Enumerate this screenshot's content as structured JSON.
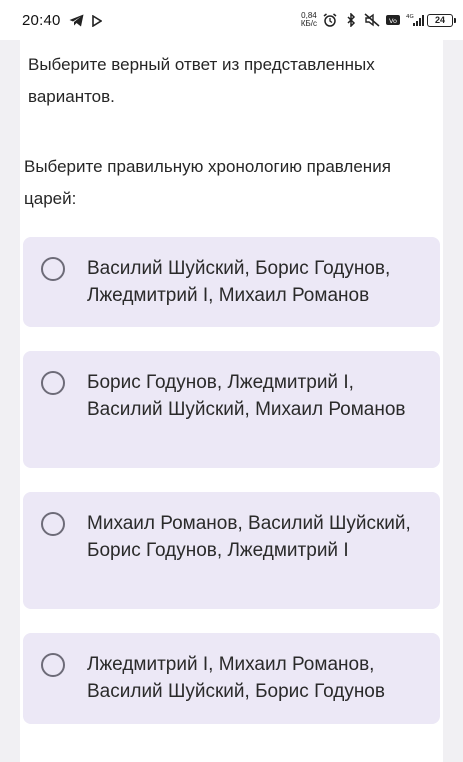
{
  "status_bar": {
    "time": "20:40",
    "net_speed_value": "0,84",
    "net_speed_unit": "КБ/с",
    "network_type": "4G",
    "battery": "24"
  },
  "instruction": "Выберите верный ответ из представленных вариантов.",
  "question": "Выберите правильную хронологию правления царей:",
  "options": [
    {
      "label": "Василий Шуйский, Борис Годунов, Лжедмитрий I, Михаил Романов",
      "selected": false
    },
    {
      "label": "Борис Годунов, Лжедмитрий I, Василий Шуйский, Михаил Романов",
      "selected": false
    },
    {
      "label": "Михаил Романов, Василий Шуйский, Борис Годунов, Лжедмитрий I",
      "selected": false
    },
    {
      "label": "Лжедмитрий I, Михаил Романов, Василий Шуйский, Борис Годунов",
      "selected": false
    }
  ],
  "colors": {
    "option_background": "#ece8f6",
    "radio_border": "#6d6b78"
  }
}
